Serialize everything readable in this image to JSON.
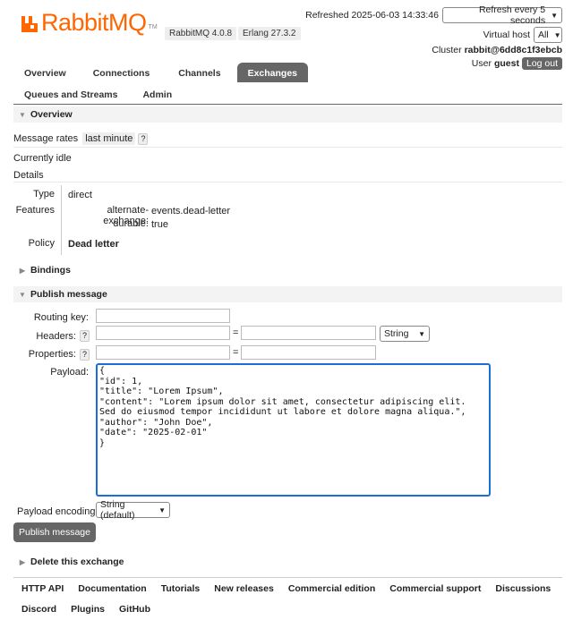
{
  "header": {
    "brand": "RabbitMQ",
    "tm": "TM",
    "rabbitmq_version": "RabbitMQ 4.0.8",
    "erlang_version": "Erlang 27.3.2",
    "refreshed": "Refreshed 2025-06-03 14:33:46",
    "refresh_select": "Refresh every 5 seconds",
    "vhost_label": "Virtual host",
    "vhost_value": "All",
    "cluster_label": "Cluster",
    "cluster_name": "rabbit@6dd8c1f3ebcb",
    "user_label": "User",
    "user_name": "guest",
    "logout": "Log out"
  },
  "nav": {
    "tabs": [
      "Overview",
      "Connections",
      "Channels",
      "Exchanges"
    ],
    "tabs_row2": [
      "Queues and Streams",
      "Admin"
    ],
    "active": "Exchanges"
  },
  "overview": {
    "title": "Overview",
    "message_rates_label": "Message rates",
    "message_rates_value": "last minute",
    "help": "?",
    "idle": "Currently idle",
    "details": "Details",
    "type_label": "Type",
    "type_value": "direct",
    "features_label": "Features",
    "feat1_key": "alternate-exchange:",
    "feat1_val": "events.dead-letter",
    "feat2_key": "durable:",
    "feat2_val": "true",
    "policy_label": "Policy",
    "policy_value": "Dead letter"
  },
  "bindings": {
    "title": "Bindings"
  },
  "publish": {
    "title": "Publish message",
    "routing_key_label": "Routing key:",
    "headers_label": "Headers:",
    "properties_label": "Properties:",
    "equals": "=",
    "header_type": "String",
    "payload_label": "Payload:",
    "payload": "{\n\"id\": 1,\n\"title\": \"Lorem Ipsum\",\n\"content\": \"Lorem ipsum dolor sit amet, consectetur adipiscing elit. Sed do eiusmod tempor incididunt ut labore et dolore magna aliqua.\",\n\"author\": \"John Doe\",\n\"date\": \"2025-02-01\"\n}",
    "encoding_label": "Payload encoding:",
    "encoding_value": "String (default)",
    "button": "Publish message"
  },
  "delete": {
    "title": "Delete this exchange"
  },
  "footer": {
    "row1": [
      "HTTP API",
      "Documentation",
      "Tutorials",
      "New releases",
      "Commercial edition",
      "Commercial support",
      "Discussions"
    ],
    "row2": [
      "Discord",
      "Plugins",
      "GitHub"
    ]
  },
  "colors": {
    "brand": "#ff6600",
    "tab_active": "#666666",
    "focus": "#1a6ed8"
  }
}
